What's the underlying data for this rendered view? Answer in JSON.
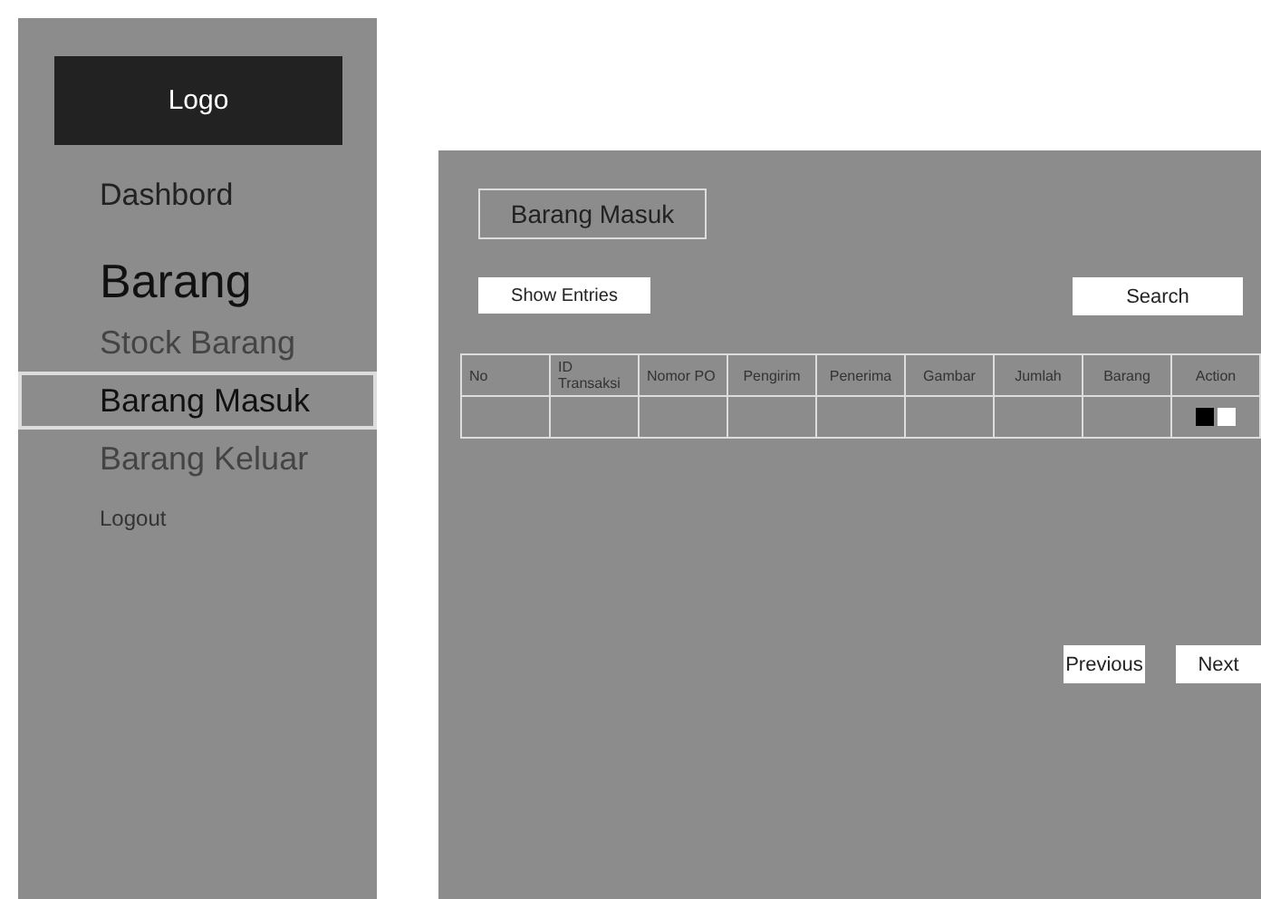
{
  "sidebar": {
    "logo": "Logo",
    "items": [
      {
        "kind": "link",
        "label": "Dashbord",
        "selected": false
      },
      {
        "kind": "heading",
        "label": "Barang",
        "selected": false
      },
      {
        "kind": "sublink",
        "label": "Stock Barang",
        "selected": false
      },
      {
        "kind": "sublink",
        "label": "Barang Masuk",
        "selected": true
      },
      {
        "kind": "sublink",
        "label": "Barang Keluar",
        "selected": false
      },
      {
        "kind": "small",
        "label": "Logout",
        "selected": false
      }
    ]
  },
  "panel": {
    "title": "Barang Masuk",
    "show_entries": "Show Entries",
    "search": {
      "placeholder": "Search"
    },
    "table": {
      "columns": [
        "No",
        "ID Transaksi",
        "Nomor PO",
        "Pengirim",
        "Penerima",
        "Gambar",
        "Jumlah",
        "Barang",
        "Action"
      ],
      "rows": [
        {
          "cells": [
            "",
            "",
            "",
            "",
            "",
            "",
            "",
            ""
          ],
          "actions": [
            {
              "color": "#000000"
            },
            {
              "color": "#ffffff"
            }
          ]
        }
      ]
    },
    "pagination": [
      "Previous",
      "Next"
    ]
  }
}
